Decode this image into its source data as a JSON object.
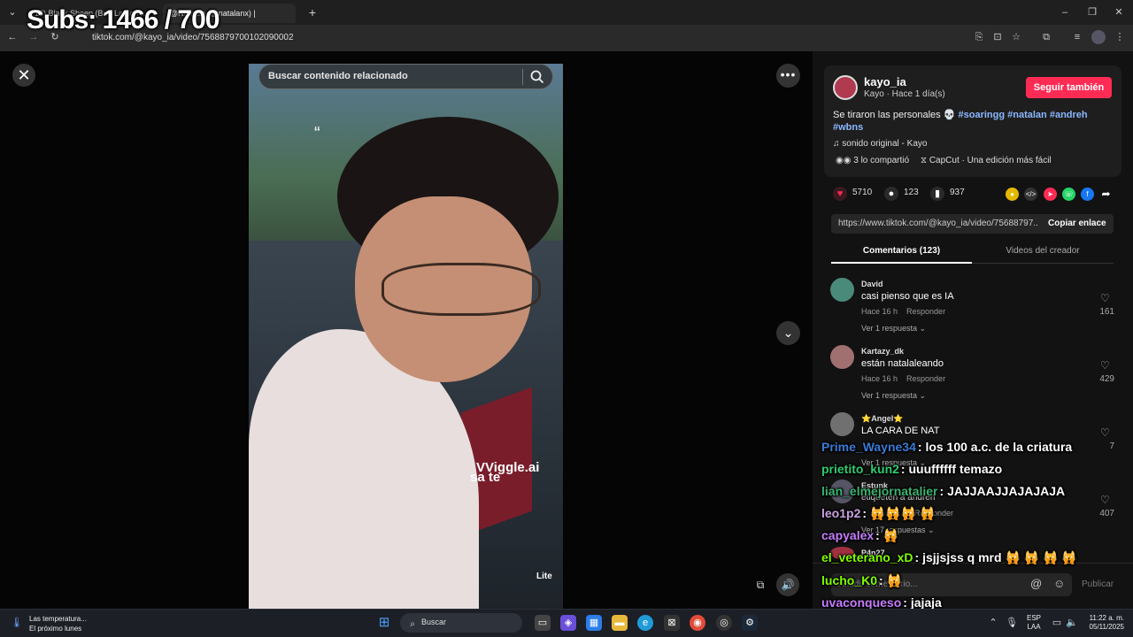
{
  "browser": {
    "tabs": [
      {
        "label": "(13) Black Sheep (Brie Larson ..."
      },
      {
        "label": "@Natalan (@natalanx) |"
      }
    ],
    "url": "tiktok.com/@kayo_ia/video/7568879700102090002",
    "new_tab": "+"
  },
  "overlay": {
    "subs": "Subs: 1466 / 700"
  },
  "video": {
    "search_placeholder": "Buscar contenido relacionado",
    "watermark": "Viggle.ai",
    "watermark_text": "sa te",
    "lite_label": "Lite",
    "quote_mark": "“"
  },
  "post": {
    "username": "kayo_ia",
    "subline": "Kayo · Hace 1 día(s)",
    "follow_label": "Seguir también",
    "caption": "Se tiraron las personales 💀",
    "tags": [
      "#soaringg",
      "#natalan",
      "#andreh",
      "#wbns"
    ],
    "music": "sonido original - Kayo",
    "shared": "3 lo compartió",
    "capcut": "CapCut · Una edición más fácil",
    "likes": "5710",
    "comments": "123",
    "saves": "937",
    "link": "https://www.tiktok.com/@kayo_ia/video/75688797...",
    "copy_label": "Copiar enlace"
  },
  "tabs": {
    "comments": "Comentarios (123)",
    "creator": "Videos del creador"
  },
  "comments": [
    {
      "user": "David",
      "text": "casi pienso que es IA",
      "time": "Hace 16 h",
      "reply": "Responder",
      "replies": "Ver 1 respuesta",
      "likes": "161",
      "color": "#4a8a7a"
    },
    {
      "user": "Kartazy_dk",
      "text": "están natalaleando",
      "time": "Hace 16 h",
      "reply": "Responder",
      "replies": "Ver 1 respuesta",
      "likes": "429",
      "color": "#a07070"
    },
    {
      "user": "⭐Angel⭐",
      "text": "LA CARA DE NAT",
      "time": "",
      "reply": "",
      "replies": "Ver 1 respuesta",
      "likes": "7",
      "color": "#707070"
    },
    {
      "user": "Estunk",
      "text": "etiqueten a andreh",
      "time": "",
      "reply": "Responder",
      "replies": "Ver 17 respuestas",
      "likes": "407",
      "color": "#556"
    },
    {
      "user": "P4n27",
      "text": "",
      "time": "",
      "reply": "",
      "replies": "",
      "likes": "",
      "color": "#a03040"
    }
  ],
  "composer": {
    "placeholder": "Añadir comentario...",
    "publish": "Publicar"
  },
  "chat": [
    {
      "user": "Prime_Wayne34",
      "msg": "los 100 a.c. de la criatura",
      "color": "#3a7bd5"
    },
    {
      "user": "prietito_kun2",
      "msg": "uuuffffff temazo",
      "color": "#2ecc71"
    },
    {
      "user": "lian_elmejornatalier",
      "msg": "JAJJAAJJAJAJAJA",
      "color": "#3cb371"
    },
    {
      "user": "leo1p2",
      "msg": "🙀🙀🙀 🙀",
      "color": "#c8a2e0"
    },
    {
      "user": "capyalex",
      "msg": "🙀",
      "color": "#c77dff"
    },
    {
      "user": "el_veterano_xD",
      "msg": "jsjjsjss q mrd 🙀 🙀 🙀 🙀",
      "color": "#7fff00"
    },
    {
      "user": "lucho_K0",
      "msg": "🙀",
      "color": "#7fff00"
    },
    {
      "user": "uvaconqueso",
      "msg": "jajaja",
      "color": "#c77dff"
    }
  ],
  "taskbar": {
    "weather_title": "Las temperatura...",
    "weather_sub": "El próximo lunes",
    "search": "Buscar",
    "lang1": "ESP",
    "lang2": "LAA",
    "time": "11:22 a. m.",
    "date": "05/11/2025"
  }
}
